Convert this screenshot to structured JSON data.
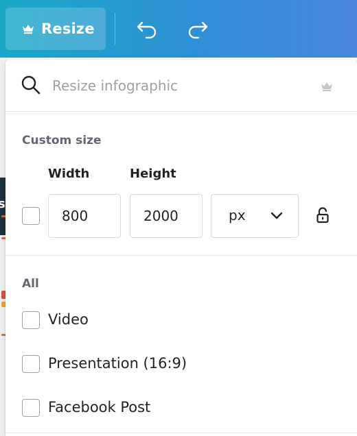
{
  "toolbar": {
    "resize_label": "Resize",
    "resize_icon": "crown-icon",
    "undo_icon": "undo-icon",
    "redo_icon": "redo-icon",
    "colors": {
      "gradient_start": "#19a9c6",
      "gradient_end": "#4a86dc"
    }
  },
  "search": {
    "placeholder": "Resize infographic",
    "value": "",
    "icon": "search-icon",
    "pro_icon": "crown-icon"
  },
  "custom_size": {
    "title": "Custom size",
    "checked": false,
    "width_label": "Width",
    "height_label": "Height",
    "width_value": "800",
    "height_value": "2000",
    "unit": "px",
    "lock_icon": "unlocked-padlock-icon"
  },
  "all_section": {
    "title": "All",
    "options": [
      {
        "label": "Video",
        "checked": false
      },
      {
        "label": "Presentation (16:9)",
        "checked": false
      },
      {
        "label": "Facebook Post",
        "checked": false
      }
    ]
  }
}
